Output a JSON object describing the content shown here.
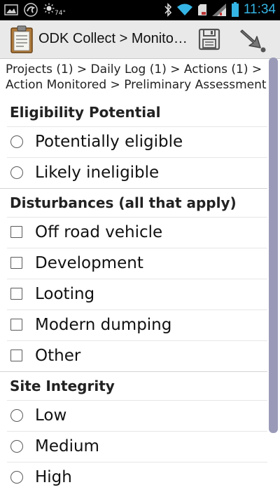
{
  "status_bar": {
    "temperature": "74°",
    "time": "11:34",
    "left_icons": [
      "image-icon",
      "swirl-app-icon",
      "weather-sun-icon"
    ],
    "right_icons": [
      "bluetooth-icon",
      "wifi-icon",
      "sd-card-icon",
      "signal-icon",
      "battery-icon"
    ]
  },
  "action_bar": {
    "app_icon": "clipboard-icon",
    "title": "ODK Collect > Monito…",
    "save_icon": "save-icon",
    "next_icon": "forward-arrow-icon"
  },
  "breadcrumb": "Projects (1) > Daily Log (1) > Actions (1) > Action Monitored > Preliminary Assessment",
  "sections": [
    {
      "title": "Eligibility Potential",
      "control": "radio",
      "options": [
        "Potentially eligible",
        "Likely ineligible"
      ]
    },
    {
      "title": "Disturbances (all that apply)",
      "control": "checkbox",
      "options": [
        "Off road vehicle",
        "Development",
        "Looting",
        "Modern dumping",
        "Other"
      ]
    },
    {
      "title": "Site Integrity",
      "control": "radio",
      "options": [
        "Low",
        "Medium",
        "High"
      ]
    }
  ],
  "colors": {
    "status_bar_bg": "#000000",
    "time_color": "#35b5e5",
    "action_bar_bg": "#e9e9e9",
    "scrollbar": "#9a9ab8"
  }
}
